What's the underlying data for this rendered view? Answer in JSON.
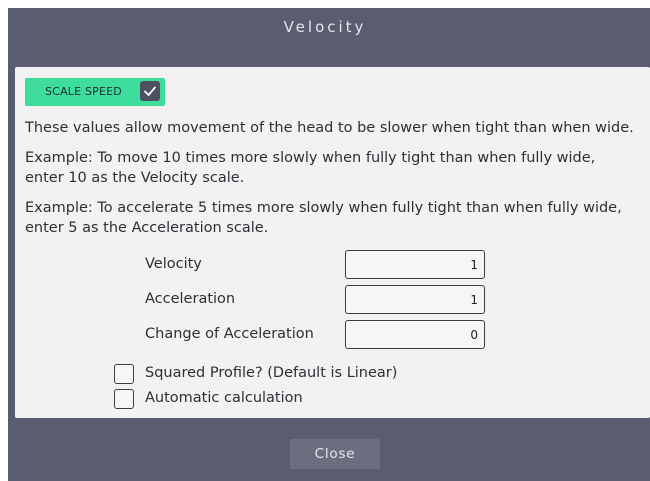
{
  "dialog": {
    "title": "Velocity",
    "close_label": "Close"
  },
  "scale_speed": {
    "label": "SCALE SPEED",
    "checked": true,
    "icon": "check-icon"
  },
  "description": {
    "line1": "These values allow movement of the head to be slower when tight than when wide.",
    "example1": "Example: To move 10 times more slowly when fully tight than when fully wide,\nenter 10 as the Velocity scale.",
    "example2": "Example: To accelerate 5 times more slowly when fully tight than when fully wide,\nenter 5 as the Acceleration scale."
  },
  "fields": {
    "velocity": {
      "label": "Velocity",
      "value": "1"
    },
    "acceleration": {
      "label": "Acceleration",
      "value": "1"
    },
    "change_of_acceleration": {
      "label": "Change of Acceleration",
      "value": "0"
    }
  },
  "options": {
    "squared_profile": {
      "label": "Squared Profile? (Default is Linear)",
      "checked": false
    },
    "automatic_calculation": {
      "label": "Automatic calculation",
      "checked": false
    }
  },
  "colors": {
    "accent": "#3edd9e",
    "dialog_bg": "#5a5d6f",
    "panel_bg": "#f2f2f2"
  }
}
